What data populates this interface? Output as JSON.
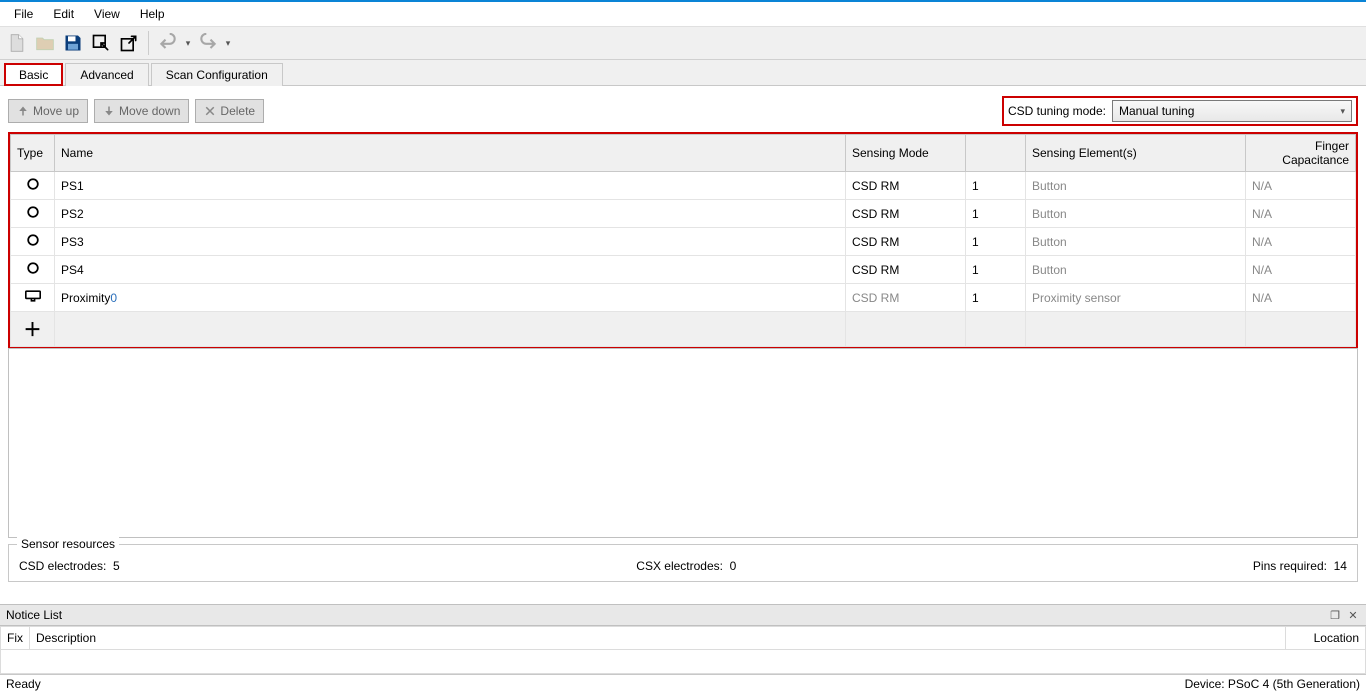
{
  "menu": {
    "file": "File",
    "edit": "Edit",
    "view": "View",
    "help": "Help"
  },
  "tabs": {
    "basic": "Basic",
    "advanced": "Advanced",
    "scan": "Scan Configuration"
  },
  "actions": {
    "moveup": "Move up",
    "movedown": "Move down",
    "delete": "Delete"
  },
  "tuning": {
    "label": "CSD tuning mode:",
    "value": "Manual tuning"
  },
  "headers": {
    "type": "Type",
    "name": "Name",
    "mode": "Sensing Mode",
    "elements": "Sensing Element(s)",
    "finger": "Finger Capacitance"
  },
  "rows": [
    {
      "name": "PS1",
      "suffix": "",
      "mode": "CSD RM",
      "count": "1",
      "kind": "Button",
      "finger": "N/A",
      "icon": "circle"
    },
    {
      "name": "PS2",
      "suffix": "",
      "mode": "CSD RM",
      "count": "1",
      "kind": "Button",
      "finger": "N/A",
      "icon": "circle"
    },
    {
      "name": "PS3",
      "suffix": "",
      "mode": "CSD RM",
      "count": "1",
      "kind": "Button",
      "finger": "N/A",
      "icon": "circle"
    },
    {
      "name": "PS4",
      "suffix": "",
      "mode": "CSD RM",
      "count": "1",
      "kind": "Button",
      "finger": "N/A",
      "icon": "circle"
    },
    {
      "name": "Proximity",
      "suffix": "0",
      "mode": "CSD RM",
      "count": "1",
      "kind": "Proximity sensor",
      "finger": "N/A",
      "icon": "prox",
      "mode_grey": true
    }
  ],
  "sensorres": {
    "legend": "Sensor resources",
    "csd_lbl": "CSD electrodes:",
    "csd_val": "5",
    "csx_lbl": "CSX electrodes:",
    "csx_val": "0",
    "pins_lbl": "Pins required:",
    "pins_val": "14"
  },
  "notice": {
    "title": "Notice List",
    "fix": "Fix",
    "desc": "Description",
    "loc": "Location"
  },
  "status": {
    "ready": "Ready",
    "device": "Device: PSoC 4 (5th Generation)"
  }
}
